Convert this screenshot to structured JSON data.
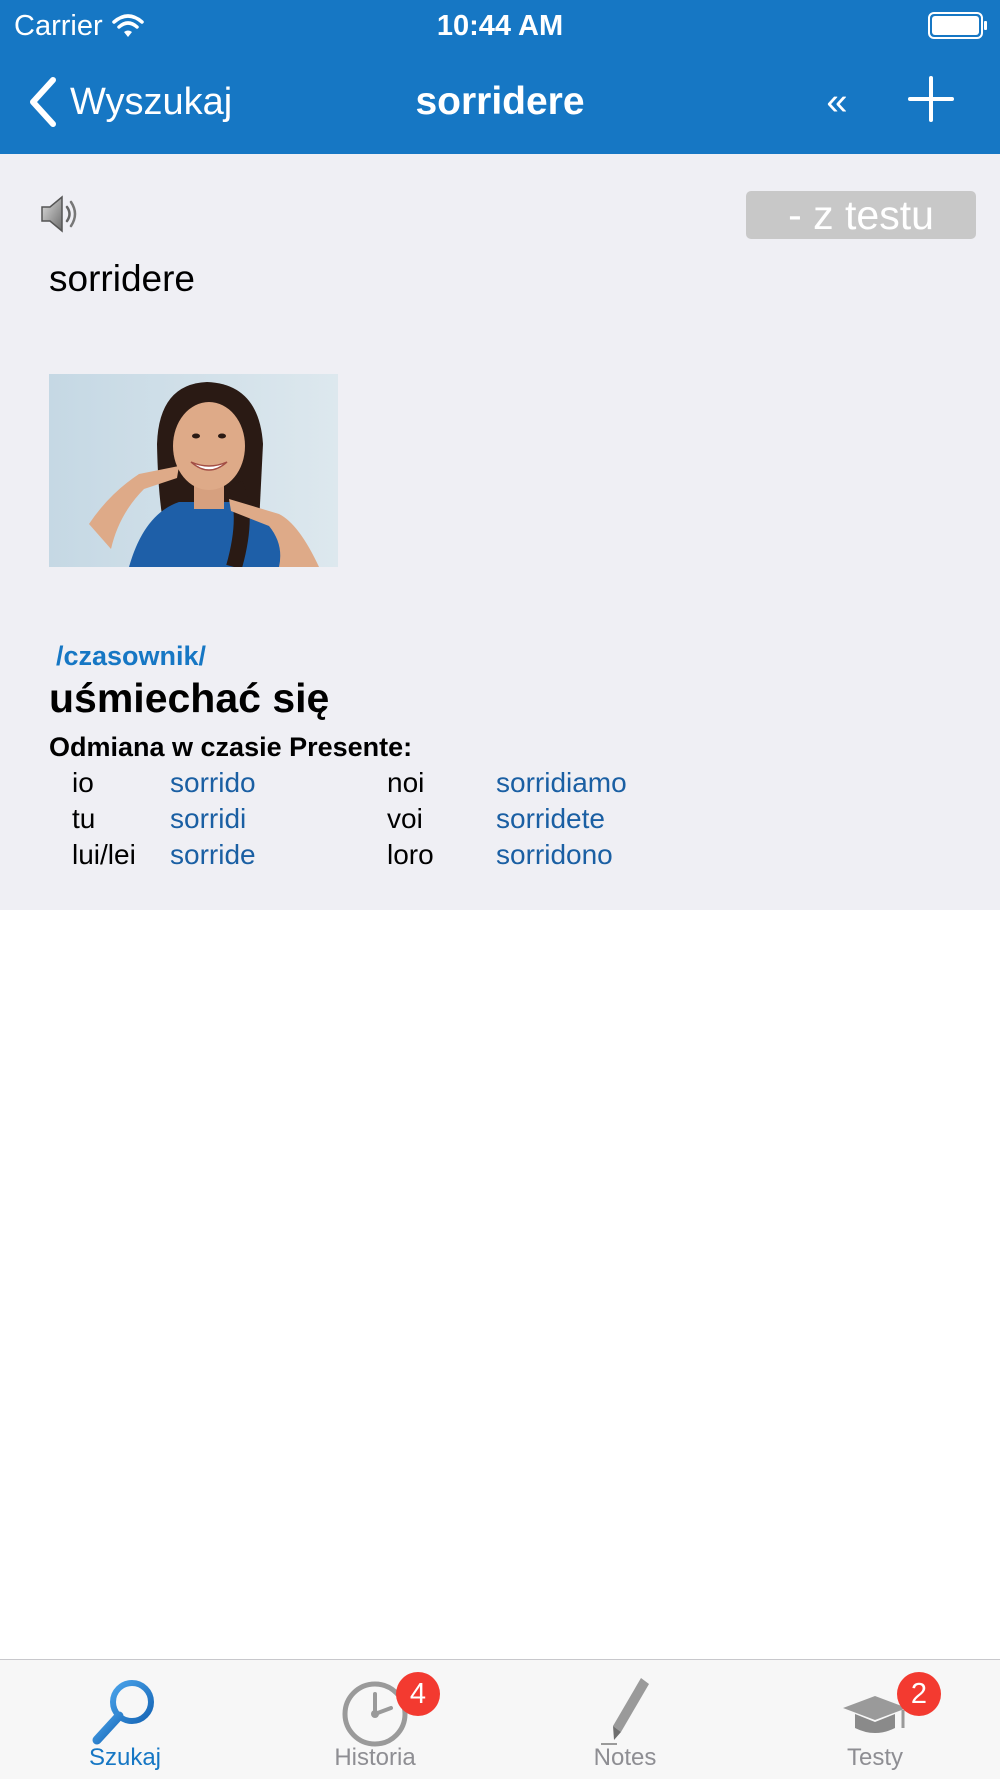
{
  "status_bar": {
    "carrier": "Carrier",
    "time": "10:44 AM"
  },
  "nav": {
    "back_label": "Wyszukaj",
    "title": "sorridere",
    "prev_label": "«"
  },
  "entry": {
    "test_button_label": "- z testu",
    "headword": "sorridere",
    "part_of_speech": "/czasownik/",
    "translation": "uśmiechać się",
    "conjugation_heading": "Odmiana w czasie Presente:",
    "conjugation": [
      {
        "pronoun_1": "io",
        "form_1": "sorrido",
        "pronoun_2": "noi",
        "form_2": "sorridiamo"
      },
      {
        "pronoun_1": "tu",
        "form_1": "sorridi",
        "pronoun_2": "voi",
        "form_2": "sorridete"
      },
      {
        "pronoun_1": "lui/lei",
        "form_1": "sorride",
        "pronoun_2": "loro",
        "form_2": "sorridono"
      }
    ]
  },
  "tabbar": {
    "tabs": [
      {
        "label": "Szukaj",
        "icon": "search-icon",
        "active": true
      },
      {
        "label": "Historia",
        "icon": "clock-icon",
        "badge": "4"
      },
      {
        "label": "Notes",
        "icon": "pen-icon"
      },
      {
        "label": "Testy",
        "icon": "graduation-cap-icon",
        "badge": "2"
      }
    ]
  },
  "colors": {
    "accent": "#1677c4",
    "content_background": "#efeff4",
    "badge": "#f33a30",
    "inactive_tab": "#8e8e93"
  }
}
